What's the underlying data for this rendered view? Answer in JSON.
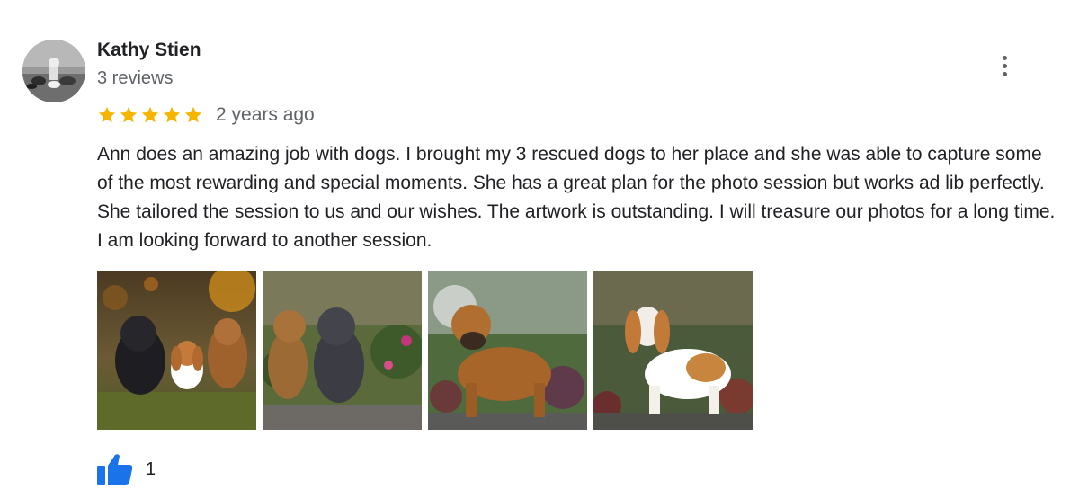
{
  "reviewer": {
    "name": "Kathy Stien",
    "review_count": "3 reviews"
  },
  "review": {
    "rating": 5,
    "max_rating": 5,
    "age": "2 years ago",
    "text": "Ann does an amazing job with dogs.  I brought my 3 rescued dogs to her place and she was able to capture some of the most rewarding and special moments.  She has a great plan for the photo session but works ad lib perfectly.  She tailored the session to us and our wishes.  The artwork is outstanding.  I will treasure our photos for a long time.  I am looking forward to another session."
  },
  "photos": [
    {
      "icon": "dog-photo-thumbnail"
    },
    {
      "icon": "dog-photo-thumbnail"
    },
    {
      "icon": "dog-photo-thumbnail"
    },
    {
      "icon": "dog-photo-thumbnail"
    }
  ],
  "likes": {
    "count": "1",
    "icon": "thumbs-up-icon"
  },
  "colors": {
    "star": "#f4b400",
    "like": "#1a73e8",
    "secondary_text": "#5f6368"
  }
}
